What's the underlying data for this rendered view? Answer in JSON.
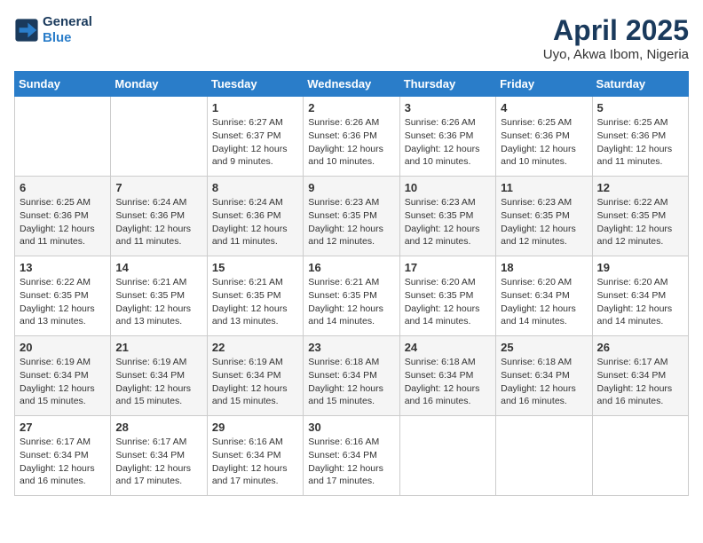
{
  "header": {
    "logo_line1": "General",
    "logo_line2": "Blue",
    "title": "April 2025",
    "subtitle": "Uyo, Akwa Ibom, Nigeria"
  },
  "days_of_week": [
    "Sunday",
    "Monday",
    "Tuesday",
    "Wednesday",
    "Thursday",
    "Friday",
    "Saturday"
  ],
  "weeks": [
    [
      {
        "day": "",
        "info": ""
      },
      {
        "day": "",
        "info": ""
      },
      {
        "day": "1",
        "info": "Sunrise: 6:27 AM\nSunset: 6:37 PM\nDaylight: 12 hours and 9 minutes."
      },
      {
        "day": "2",
        "info": "Sunrise: 6:26 AM\nSunset: 6:36 PM\nDaylight: 12 hours and 10 minutes."
      },
      {
        "day": "3",
        "info": "Sunrise: 6:26 AM\nSunset: 6:36 PM\nDaylight: 12 hours and 10 minutes."
      },
      {
        "day": "4",
        "info": "Sunrise: 6:25 AM\nSunset: 6:36 PM\nDaylight: 12 hours and 10 minutes."
      },
      {
        "day": "5",
        "info": "Sunrise: 6:25 AM\nSunset: 6:36 PM\nDaylight: 12 hours and 11 minutes."
      }
    ],
    [
      {
        "day": "6",
        "info": "Sunrise: 6:25 AM\nSunset: 6:36 PM\nDaylight: 12 hours and 11 minutes."
      },
      {
        "day": "7",
        "info": "Sunrise: 6:24 AM\nSunset: 6:36 PM\nDaylight: 12 hours and 11 minutes."
      },
      {
        "day": "8",
        "info": "Sunrise: 6:24 AM\nSunset: 6:36 PM\nDaylight: 12 hours and 11 minutes."
      },
      {
        "day": "9",
        "info": "Sunrise: 6:23 AM\nSunset: 6:35 PM\nDaylight: 12 hours and 12 minutes."
      },
      {
        "day": "10",
        "info": "Sunrise: 6:23 AM\nSunset: 6:35 PM\nDaylight: 12 hours and 12 minutes."
      },
      {
        "day": "11",
        "info": "Sunrise: 6:23 AM\nSunset: 6:35 PM\nDaylight: 12 hours and 12 minutes."
      },
      {
        "day": "12",
        "info": "Sunrise: 6:22 AM\nSunset: 6:35 PM\nDaylight: 12 hours and 12 minutes."
      }
    ],
    [
      {
        "day": "13",
        "info": "Sunrise: 6:22 AM\nSunset: 6:35 PM\nDaylight: 12 hours and 13 minutes."
      },
      {
        "day": "14",
        "info": "Sunrise: 6:21 AM\nSunset: 6:35 PM\nDaylight: 12 hours and 13 minutes."
      },
      {
        "day": "15",
        "info": "Sunrise: 6:21 AM\nSunset: 6:35 PM\nDaylight: 12 hours and 13 minutes."
      },
      {
        "day": "16",
        "info": "Sunrise: 6:21 AM\nSunset: 6:35 PM\nDaylight: 12 hours and 14 minutes."
      },
      {
        "day": "17",
        "info": "Sunrise: 6:20 AM\nSunset: 6:35 PM\nDaylight: 12 hours and 14 minutes."
      },
      {
        "day": "18",
        "info": "Sunrise: 6:20 AM\nSunset: 6:34 PM\nDaylight: 12 hours and 14 minutes."
      },
      {
        "day": "19",
        "info": "Sunrise: 6:20 AM\nSunset: 6:34 PM\nDaylight: 12 hours and 14 minutes."
      }
    ],
    [
      {
        "day": "20",
        "info": "Sunrise: 6:19 AM\nSunset: 6:34 PM\nDaylight: 12 hours and 15 minutes."
      },
      {
        "day": "21",
        "info": "Sunrise: 6:19 AM\nSunset: 6:34 PM\nDaylight: 12 hours and 15 minutes."
      },
      {
        "day": "22",
        "info": "Sunrise: 6:19 AM\nSunset: 6:34 PM\nDaylight: 12 hours and 15 minutes."
      },
      {
        "day": "23",
        "info": "Sunrise: 6:18 AM\nSunset: 6:34 PM\nDaylight: 12 hours and 15 minutes."
      },
      {
        "day": "24",
        "info": "Sunrise: 6:18 AM\nSunset: 6:34 PM\nDaylight: 12 hours and 16 minutes."
      },
      {
        "day": "25",
        "info": "Sunrise: 6:18 AM\nSunset: 6:34 PM\nDaylight: 12 hours and 16 minutes."
      },
      {
        "day": "26",
        "info": "Sunrise: 6:17 AM\nSunset: 6:34 PM\nDaylight: 12 hours and 16 minutes."
      }
    ],
    [
      {
        "day": "27",
        "info": "Sunrise: 6:17 AM\nSunset: 6:34 PM\nDaylight: 12 hours and 16 minutes."
      },
      {
        "day": "28",
        "info": "Sunrise: 6:17 AM\nSunset: 6:34 PM\nDaylight: 12 hours and 17 minutes."
      },
      {
        "day": "29",
        "info": "Sunrise: 6:16 AM\nSunset: 6:34 PM\nDaylight: 12 hours and 17 minutes."
      },
      {
        "day": "30",
        "info": "Sunrise: 6:16 AM\nSunset: 6:34 PM\nDaylight: 12 hours and 17 minutes."
      },
      {
        "day": "",
        "info": ""
      },
      {
        "day": "",
        "info": ""
      },
      {
        "day": "",
        "info": ""
      }
    ]
  ]
}
